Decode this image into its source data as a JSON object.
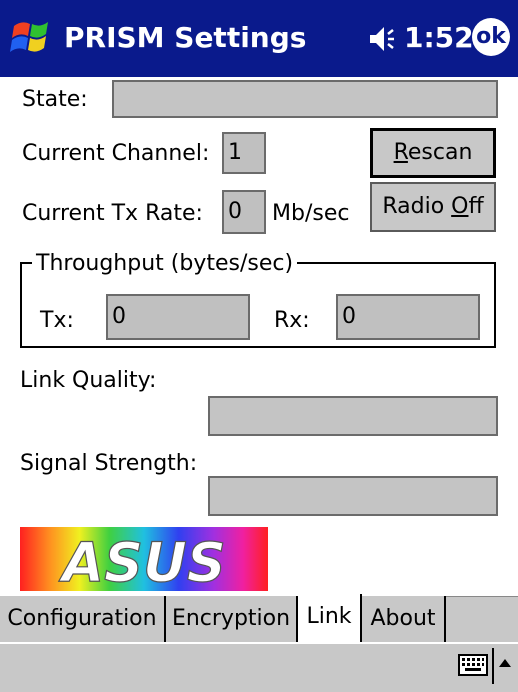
{
  "titlebar": {
    "title": "PRISM Settings",
    "time": "1:52",
    "ok": "ok"
  },
  "link": {
    "state_label": "State:",
    "state_value": "",
    "channel_label": "Current Channel:",
    "channel_value": "1",
    "rate_label": "Current Tx Rate:",
    "rate_value": "0",
    "rate_unit": "Mb/sec",
    "rescan_mn": "R",
    "rescan_rest": "escan",
    "radio_prefix": "Radio ",
    "radio_mn": "O",
    "radio_rest": "ff",
    "throughput_title": "Throughput (bytes/sec)",
    "tx_label": "Tx:",
    "tx_value": "0",
    "rx_label": "Rx:",
    "rx_value": "0",
    "link_quality_label": "Link Quality:",
    "link_quality_value": "",
    "signal_label": "Signal Strength:",
    "signal_value": "",
    "logo_text": "ASUS"
  },
  "tabs": [
    "Configuration",
    "Encryption",
    "Link",
    "About"
  ],
  "active_tab": "Link",
  "colors": {
    "titlebar": "#0a1a8c",
    "field": "#c0c0c0",
    "chrome": "#c8c8c8"
  },
  "icons": {
    "start": "windows-flag-icon",
    "volume": "speaker-icon",
    "sip": "keyboard-icon"
  }
}
